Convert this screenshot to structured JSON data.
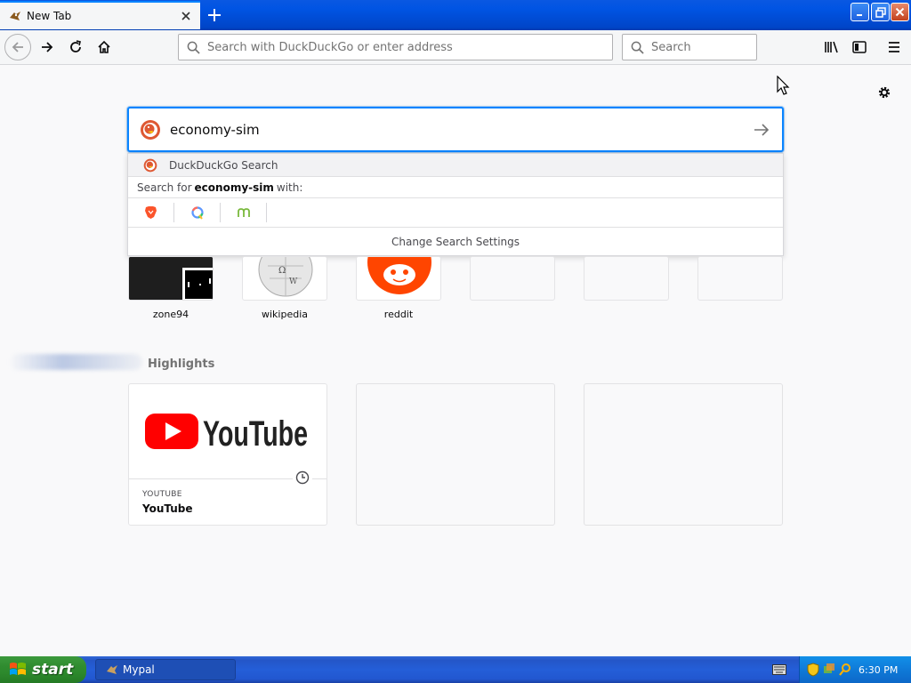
{
  "browser": {
    "tab": {
      "title": "New Tab"
    },
    "urlbar": {
      "placeholder": "Search with DuckDuckGo or enter address"
    },
    "searchbar": {
      "placeholder": "Search"
    }
  },
  "newtab": {
    "search": {
      "value": "economy-sim",
      "dropdown": {
        "suggestion": "DuckDuckGo Search",
        "search_for_prefix": "Search for",
        "search_for_term": "economy-sim",
        "search_for_suffix": "with:",
        "engines": [
          "brave-icon",
          "qwant-icon",
          "mojeek-icon"
        ],
        "settings_label": "Change Search Settings"
      }
    },
    "top_sites": [
      {
        "label": "zone94",
        "icon": "zone94-thumbnail"
      },
      {
        "label": "wikipedia",
        "icon": "wikipedia-globe-icon"
      },
      {
        "label": "reddit",
        "icon": "reddit-icon"
      },
      {
        "label": "",
        "icon": ""
      },
      {
        "label": "",
        "icon": ""
      },
      {
        "label": "",
        "icon": ""
      }
    ],
    "highlights": {
      "title": "Highlights",
      "cards": [
        {
          "host": "YOUTUBE",
          "title": "YouTube",
          "logo_text": "YouTube"
        }
      ]
    }
  },
  "taskbar": {
    "start_label": "start",
    "task_label": "Mypal",
    "time": "6:30 PM"
  },
  "colors": {
    "accent": "#0a84ff",
    "youtube_red": "#ff0000",
    "reddit_orange": "#ff4500"
  }
}
